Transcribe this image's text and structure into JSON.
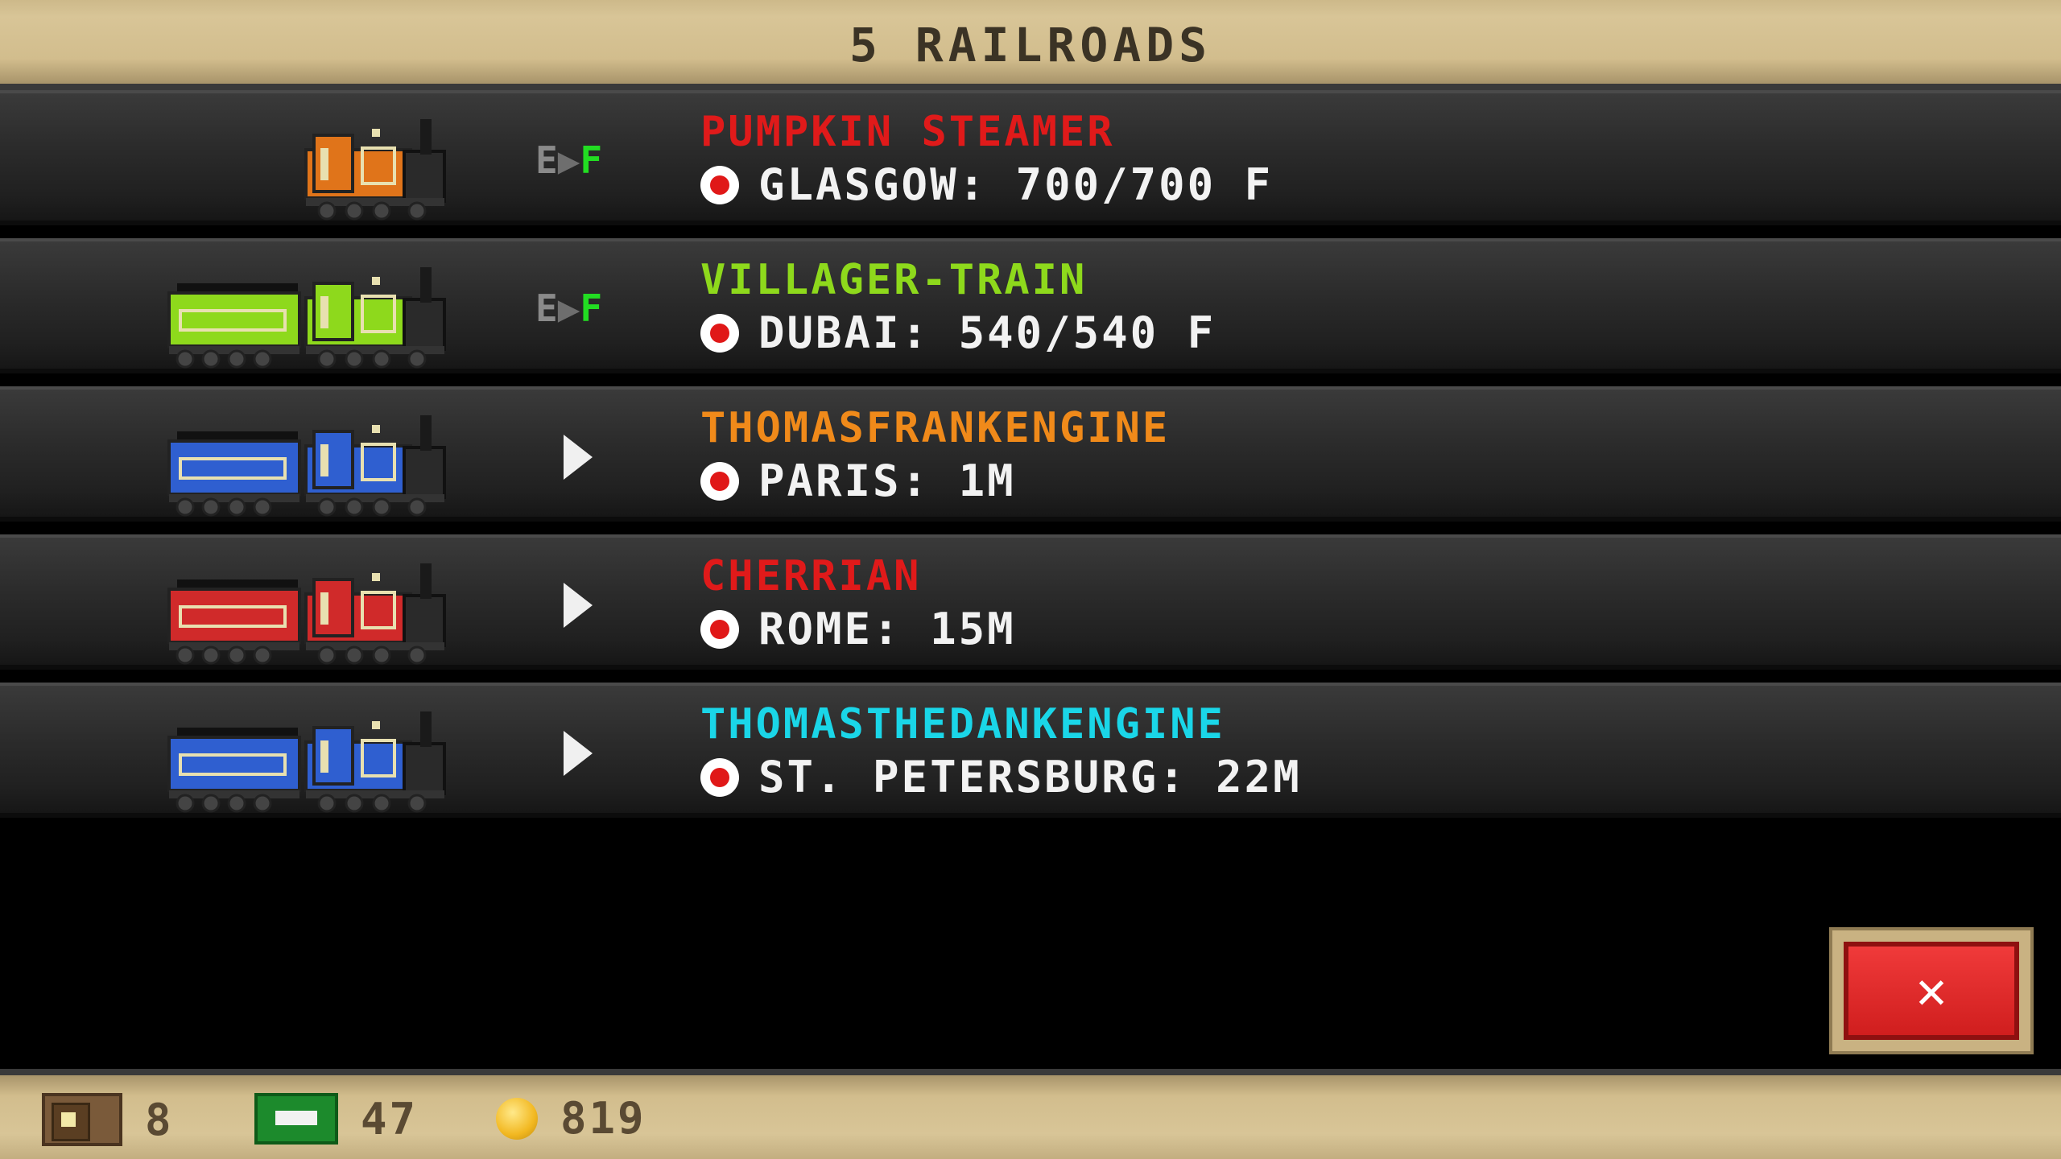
{
  "header": {
    "title": "5 RAILROADS"
  },
  "status_indicator": {
    "e": "E",
    "arrow": "▶",
    "f": "F"
  },
  "trains": [
    {
      "name": "PUMPKIN STEAMER",
      "name_color": "#e01a1a",
      "location": "GLASGOW: 700/700 F",
      "mode": "loading",
      "engine_color": "#e0741a",
      "tender": false,
      "tender_color": ""
    },
    {
      "name": "VILLAGER-TRAIN",
      "name_color": "#8ed91c",
      "location": "DUBAI: 540/540 F",
      "mode": "loading",
      "engine_color": "#8ed91c",
      "tender": true,
      "tender_color": "#8ed91c"
    },
    {
      "name": "THOMASFRANKENGINE",
      "name_color": "#f08a1a",
      "location": "PARIS: 1M",
      "mode": "moving",
      "engine_color": "#2f5fd0",
      "tender": true,
      "tender_color": "#2f5fd0"
    },
    {
      "name": "CHERRIAN",
      "name_color": "#e01a1a",
      "location": "ROME: 15M",
      "mode": "moving",
      "engine_color": "#d02a2a",
      "tender": true,
      "tender_color": "#d02a2a"
    },
    {
      "name": "THOMASTHEDANKENGINE",
      "name_color": "#1ad6e8",
      "location": "ST. PETERSBURG: 22M",
      "mode": "moving",
      "engine_color": "#2f5fd0",
      "tender": true,
      "tender_color": "#2f5fd0"
    }
  ],
  "close_button": {
    "label": "✕"
  },
  "footer": {
    "tickets": "8",
    "cash": "47",
    "coins": "819"
  }
}
